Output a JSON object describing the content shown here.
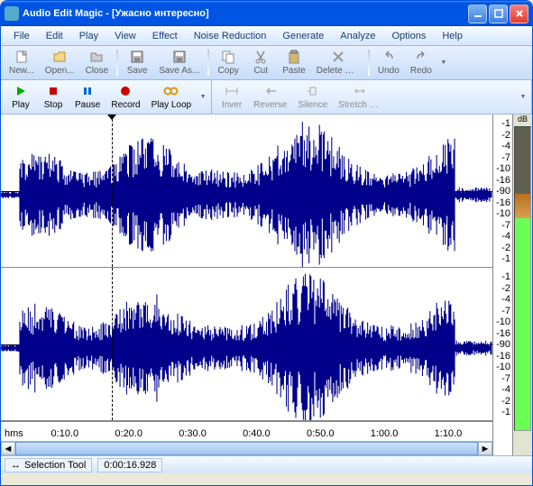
{
  "title": "Audio Edit Magic - [Ужасно интересно]",
  "menu": [
    "File",
    "Edit",
    "Play",
    "View",
    "Effect",
    "Noise Reduction",
    "Generate",
    "Analyze",
    "Options",
    "Help"
  ],
  "toolbar1": {
    "new": "New...",
    "open": "Open...",
    "close": "Close",
    "save": "Save",
    "saveas": "Save As...",
    "copy": "Copy",
    "cut": "Cut",
    "paste": "Paste",
    "delsel": "Delete Selection",
    "undo": "Undo",
    "redo": "Redo"
  },
  "transport": {
    "play": "Play",
    "stop": "Stop",
    "pause": "Pause",
    "record": "Record",
    "playloop": "Play Loop"
  },
  "fx": {
    "invert": "Inver",
    "reverse": "Reverse",
    "silence": "Silence",
    "stretch": "Stretch Time..."
  },
  "db_header": "dB",
  "db_labels": [
    "-1",
    "-2",
    "-4",
    "-7",
    "-10",
    "-16",
    "-90",
    "-16",
    "-10",
    "-7",
    "-4",
    "-2",
    "-1"
  ],
  "time_hms": "hms",
  "time_ticks": [
    "0:10.0",
    "0:20.0",
    "0:30.0",
    "0:40.0",
    "0:50.0",
    "1:00.0",
    "1:10.0"
  ],
  "status": {
    "tool_icon": "↔",
    "tool_label": "Selection Tool",
    "timecode": "0:00:16.928"
  }
}
